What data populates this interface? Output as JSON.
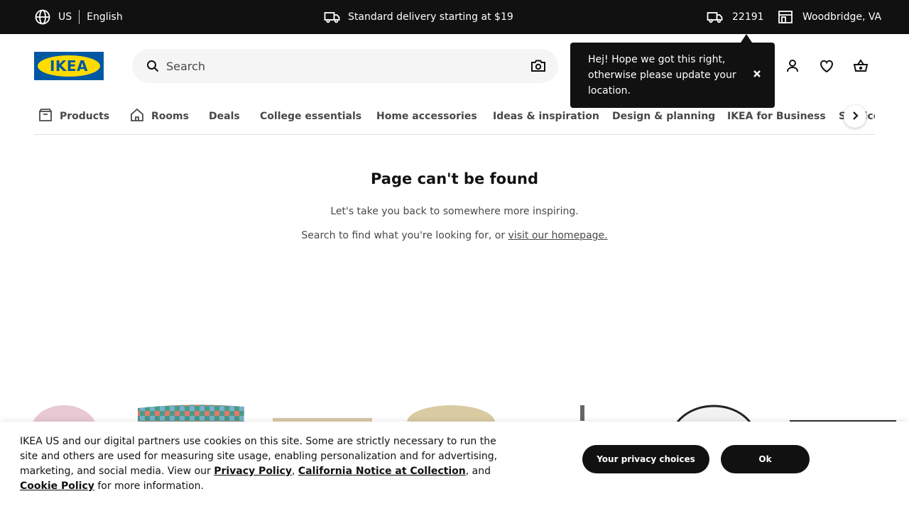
{
  "topbar": {
    "country": "US",
    "language": "English",
    "delivery_text": "Standard delivery starting at $19",
    "zip": "22191",
    "store": "Woodbridge, VA"
  },
  "header": {
    "logo_text": "IKEA",
    "search_placeholder": "Search"
  },
  "tooltip": {
    "text": "Hej! Hope we got this right, otherwise please update your location."
  },
  "nav": {
    "tabs": [
      {
        "label": "Products"
      },
      {
        "label": "Rooms"
      },
      {
        "label": "Deals"
      },
      {
        "label": "College essentials"
      },
      {
        "label": "Home accessories"
      },
      {
        "label": "Ideas & inspiration"
      },
      {
        "label": "Design & planning"
      },
      {
        "label": "IKEA for Business"
      },
      {
        "label": "Services"
      }
    ]
  },
  "main": {
    "title": "Page can't be found",
    "line1": "Let's take you back to somewhere more inspiring.",
    "line2_prefix": "Search to find what you're looking for, or ",
    "homepage_link": "visit our homepage."
  },
  "cookie": {
    "text_part1": "IKEA US and our digital partners use cookies on this site. Some are strictly necessary to run the site and others are used for measuring site usage, enabling personalization and for advertising, marketing, and social media. View our ",
    "privacy_link": "Privacy Policy",
    "comma": ", ",
    "california_link": "California Notice at Collection",
    "and_text": ", and ",
    "cookie_link": "Cookie Policy",
    "text_end": " for more information.",
    "privacy_choices_label": "Your privacy choices",
    "ok_label": "Ok"
  },
  "colors": {
    "brand_blue": "#0058a3",
    "brand_yellow": "#ffdb00",
    "dark": "#111111"
  }
}
